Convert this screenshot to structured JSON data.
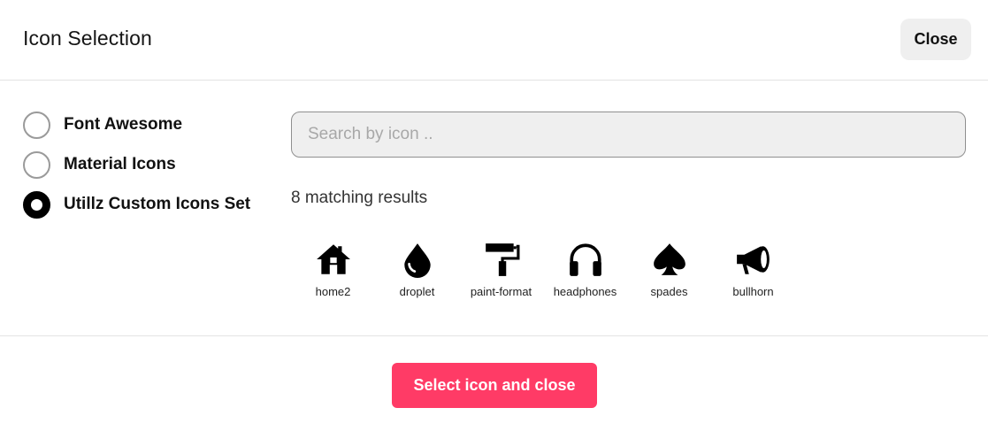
{
  "header": {
    "title": "Icon Selection",
    "close_label": "Close"
  },
  "sources": [
    {
      "label": "Font Awesome",
      "checked": false
    },
    {
      "label": "Material Icons",
      "checked": false
    },
    {
      "label": "Utillz Custom Icons Set",
      "checked": true
    }
  ],
  "search": {
    "placeholder": "Search by icon ..",
    "value": ""
  },
  "results": {
    "count_text": "8 matching results"
  },
  "icons": [
    {
      "name": "home2",
      "icon": "home-icon"
    },
    {
      "name": "droplet",
      "icon": "droplet-icon"
    },
    {
      "name": "paint-format",
      "icon": "paint-roller-icon"
    },
    {
      "name": "headphones",
      "icon": "headphones-icon"
    },
    {
      "name": "spades",
      "icon": "spade-icon"
    },
    {
      "name": "bullhorn",
      "icon": "bullhorn-icon"
    }
  ],
  "footer": {
    "select_label": "Select icon and close"
  },
  "colors": {
    "accent": "#ff3b66",
    "close_bg": "#efefef",
    "search_bg": "#efefef"
  }
}
